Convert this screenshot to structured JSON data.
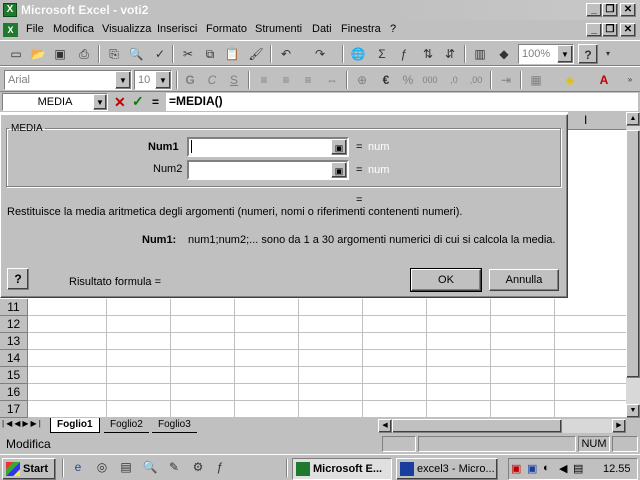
{
  "window": {
    "title": "Microsoft Excel - voti2"
  },
  "menu": [
    {
      "label": "File",
      "underline": "F"
    },
    {
      "label": "Modifica",
      "underline": "M"
    },
    {
      "label": "Visualizza",
      "underline": "V"
    },
    {
      "label": "Inserisci",
      "underline": "I"
    },
    {
      "label": "Formato",
      "underline": "o"
    },
    {
      "label": "Strumenti",
      "underline": "S"
    },
    {
      "label": "Dati",
      "underline": "D"
    },
    {
      "label": "Finestra",
      "underline": "n"
    },
    {
      "label": "?",
      "underline": "?"
    }
  ],
  "toolbar": {
    "zoom": "100%"
  },
  "format_toolbar": {
    "font": "Arial",
    "size": "10"
  },
  "formula_bar": {
    "name_box": "MEDIA",
    "equals": "=",
    "formula": "=MEDIA()"
  },
  "dialog": {
    "group_title": "MEDIA",
    "args": [
      {
        "label": "Num1",
        "value": "",
        "equals": "=",
        "result": "num"
      },
      {
        "label": "Num2",
        "value": "",
        "equals": "=",
        "result": "num"
      }
    ],
    "total_equals": "=",
    "description": "Restituisce la media aritmetica degli argomenti (numeri, nomi o riferimenti contenenti numeri).",
    "arg_help_label": "Num1:",
    "arg_help_text": "num1;num2;... sono da 1 a 30 argomenti numerici di cui si calcola la media.",
    "help_button": "?",
    "result_label": "Risultato formula =",
    "ok_label": "OK",
    "cancel_label": "Annulla"
  },
  "rows": [
    "11",
    "12",
    "13",
    "14",
    "15",
    "16",
    "17"
  ],
  "partial_col_header": "I",
  "sheet_tabs": [
    "Foglio1",
    "Foglio2",
    "Foglio3"
  ],
  "status": {
    "mode": "Modifica",
    "num": "NUM"
  },
  "taskbar": {
    "start": "Start",
    "tasks": [
      {
        "label": "Microsoft E...",
        "active": true
      },
      {
        "label": "excel3 - Micro...",
        "active": false
      }
    ],
    "clock": "12.55"
  }
}
